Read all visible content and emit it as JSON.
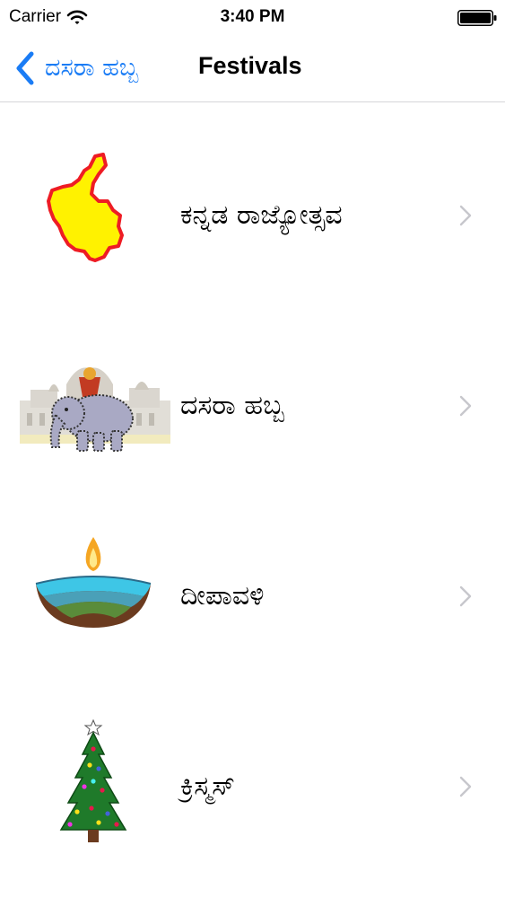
{
  "status_bar": {
    "carrier": "Carrier",
    "time": "3:40 PM"
  },
  "nav": {
    "back_label": "ದಸರಾ ಹಬ್ಬ",
    "title": "Festivals",
    "tint_color": "#1a7cf5"
  },
  "festivals": [
    {
      "label": "ಕನ್ನಡ ರಾಜ್ಯೋತ್ಸವ",
      "icon": "karnataka-map-icon"
    },
    {
      "label": "ದಸರಾ ಹಬ್ಬ",
      "icon": "dasara-elephant-palace-icon"
    },
    {
      "label": "ದೀಪಾವಳಿ",
      "icon": "diya-lamp-icon"
    },
    {
      "label": "ಕ್ರಿಸ್ಮಸ್",
      "icon": "christmas-tree-icon"
    }
  ]
}
